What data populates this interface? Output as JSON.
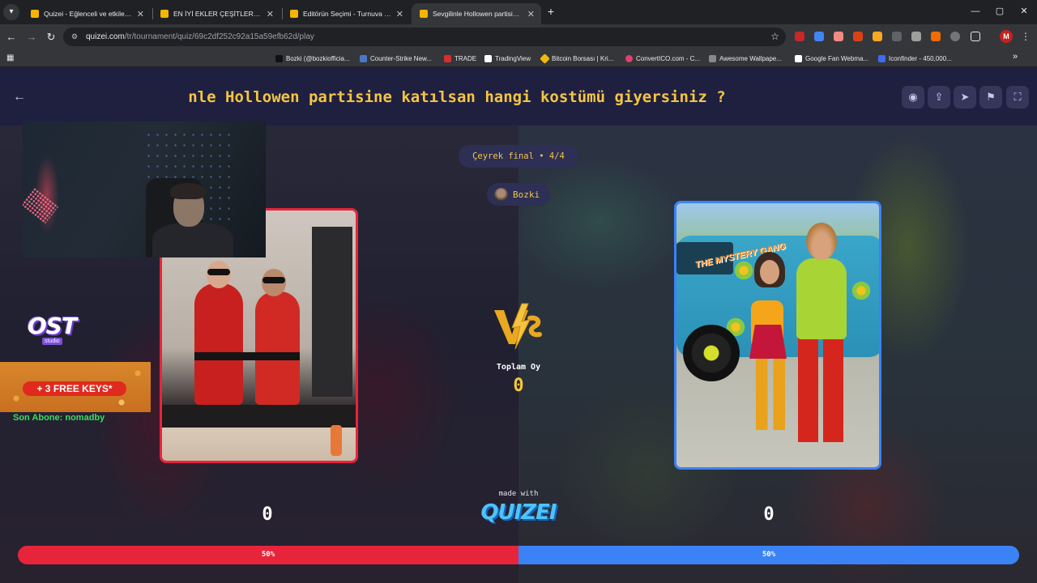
{
  "browser": {
    "tabs": [
      {
        "title": "Quizei - Eğlenceli ve etkileşimli",
        "favicon_color": "#f5b400",
        "active": false
      },
      {
        "title": "EN İYİ EKLER ÇEŞİTLERİ - Tier Li",
        "favicon_color": "#f5b400",
        "active": false
      },
      {
        "title": "Editörün Seçimi - Turnuva - Qu",
        "favicon_color": "#f5b400",
        "active": false
      },
      {
        "title": "Sevgilinle Hollowen partisine ka",
        "favicon_color": "#f5b400",
        "active": true
      }
    ],
    "new_tab_icon": "+",
    "url_host": "quizei.com",
    "url_path": "/tr/tournament/quiz/69c2df252c92a15a59efb62d/play",
    "profile_initial": "M",
    "bookmarks": [
      {
        "label": "Bozki (@bozkiofficia...",
        "favicon_color": "#000000"
      },
      {
        "label": "Counter-Strike New...",
        "favicon_color": "#4a78c8"
      },
      {
        "label": "TRADE",
        "favicon_color": "#d32f2f"
      },
      {
        "label": "TradingView",
        "favicon_color": "#ffffff"
      },
      {
        "label": "Bitcoin Borsası | Kri...",
        "favicon_color": "#f0b90b"
      },
      {
        "label": "ConvertICO.com - C...",
        "favicon_color": "#e04070"
      },
      {
        "label": "Awesome Wallpape...",
        "favicon_color": "#888888"
      },
      {
        "label": "Google Fan Webma...",
        "favicon_color": "#ffffff"
      },
      {
        "label": "Iconfinder - 450,000...",
        "favicon_color": "#3b6cf6"
      }
    ]
  },
  "page": {
    "title": "nle Hollowen partisine katılsan hangi kostümü giyersiniz ?",
    "round_label": "Çeyrek final • 4/4",
    "user_name": "Bozki",
    "total_label": "Toplam Oy",
    "total_count": "0",
    "left_score": "0",
    "right_score": "0",
    "left_percent_label": "50%",
    "right_percent_label": "50%",
    "left_share": 0.5,
    "made_with": "made with",
    "brand": "QUIZEI"
  },
  "overlay": {
    "ost_logo": "OST",
    "ost_sub": "studio",
    "keys_banner": "+ 3 FREE KEYS*",
    "last_sub": "Son Abone: nomadby"
  },
  "cards": {
    "right_van_text": "THE MYSTERY GANG"
  },
  "colors": {
    "accent_yellow": "#f5c542",
    "left_red": "#e8243b",
    "right_blue": "#3b82f6",
    "header_bg": "#1f2040"
  }
}
